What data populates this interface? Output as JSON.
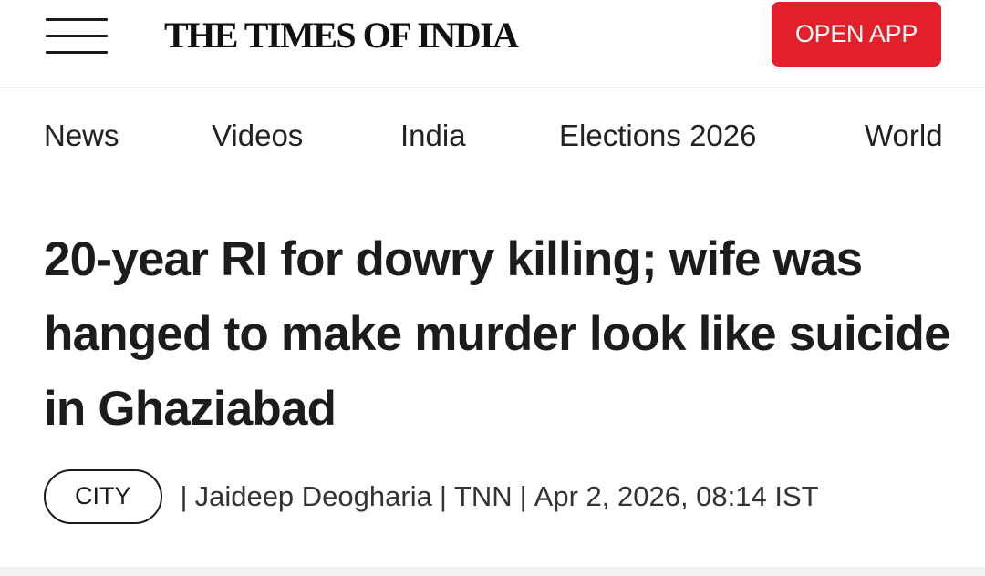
{
  "header": {
    "logo_text": "THE TIMES OF INDIA",
    "open_app_label": "OPEN APP",
    "menu_icon": "hamburger-menu-icon",
    "accent_color": "#e3202a"
  },
  "nav": {
    "items": [
      {
        "label": "News"
      },
      {
        "label": "Videos"
      },
      {
        "label": "India"
      },
      {
        "label": "Elections 2026"
      },
      {
        "label": "World"
      }
    ]
  },
  "article": {
    "headline": "20-year RI for dowry killing; wife was hanged to make murder look like suicide in Ghaziabad",
    "category": "CITY",
    "author": "Jaideep Deogharia",
    "agency": "TNN",
    "published": "Apr 2, 2026, 08:14 IST"
  }
}
